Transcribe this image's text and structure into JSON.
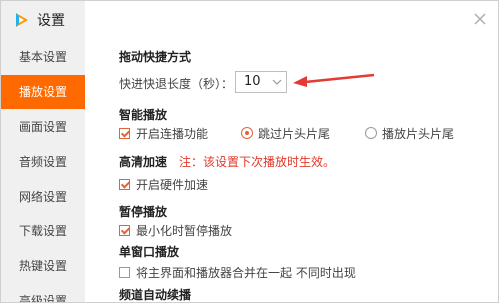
{
  "window": {
    "title": "设置"
  },
  "sidebar": {
    "items": [
      {
        "label": "基本设置",
        "active": false
      },
      {
        "label": "播放设置",
        "active": true
      },
      {
        "label": "画面设置",
        "active": false
      },
      {
        "label": "音频设置",
        "active": false
      },
      {
        "label": "网络设置",
        "active": false
      },
      {
        "label": "下载设置",
        "active": false
      },
      {
        "label": "热键设置",
        "active": false
      },
      {
        "label": "高级设置",
        "active": false
      }
    ]
  },
  "colors": {
    "accent": "#ff6a00",
    "warning": "#e0392b",
    "arrow": "#e53935"
  },
  "sections": {
    "drag_seek": {
      "title": "拖动快捷方式",
      "seek_label": "快进快退长度（秒）：",
      "seek_value": "10"
    },
    "smart_play": {
      "title": "智能播放",
      "continuous": {
        "label": "开启连播功能",
        "checked": true
      },
      "skip": {
        "label": "跳过片头片尾",
        "selected": true
      },
      "play": {
        "label": "播放片头片尾",
        "selected": false
      }
    },
    "hd_accel": {
      "title": "高清加速",
      "note": "注：该设置下次播放时生效。",
      "hardware": {
        "label": "开启硬件加速",
        "checked": true
      }
    },
    "pause": {
      "title": "暂停播放",
      "minimize": {
        "label": "最小化时暂停播放",
        "checked": true
      }
    },
    "single_window": {
      "title": "单窗口播放",
      "merge": {
        "label": "将主界面和播放器合并在一起  不同时出现",
        "checked": false
      }
    },
    "auto_continue": {
      "title": "频道自动续播"
    }
  }
}
